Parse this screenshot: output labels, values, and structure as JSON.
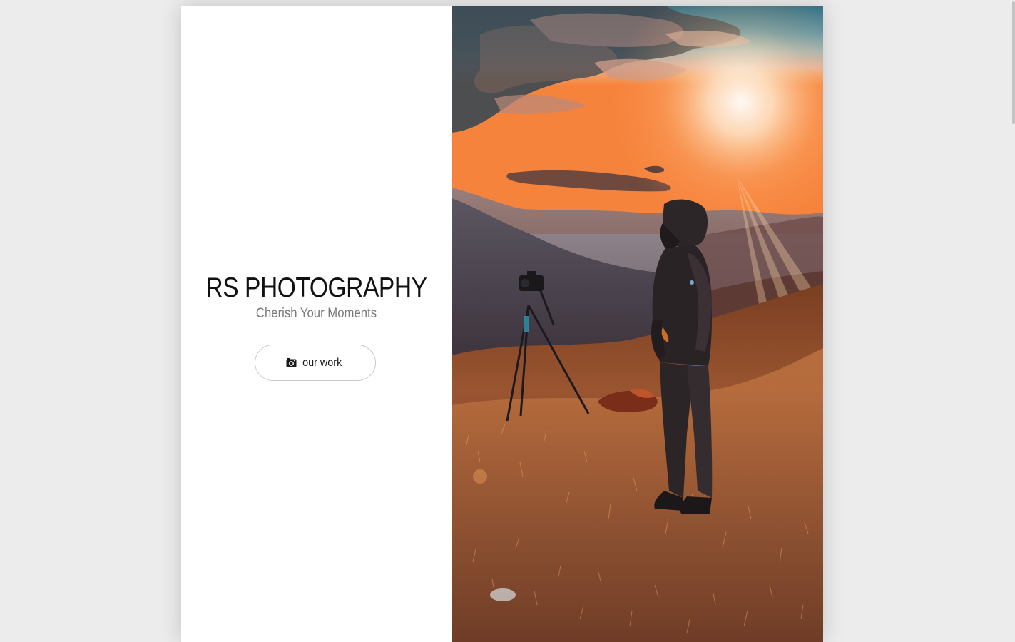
{
  "hero": {
    "title": "RS PHOTOGRAPHY",
    "tagline": "Cherish Your Moments",
    "button_label": "our work",
    "button_icon": "camera-icon"
  },
  "photo": {
    "subject": "photographer-at-sunset-with-tripod"
  },
  "colors": {
    "page_background": "#ececec",
    "card_background": "#ffffff",
    "title_text": "#111111",
    "tagline_text": "#7a7a7a",
    "button_border": "#c9c9c9"
  }
}
